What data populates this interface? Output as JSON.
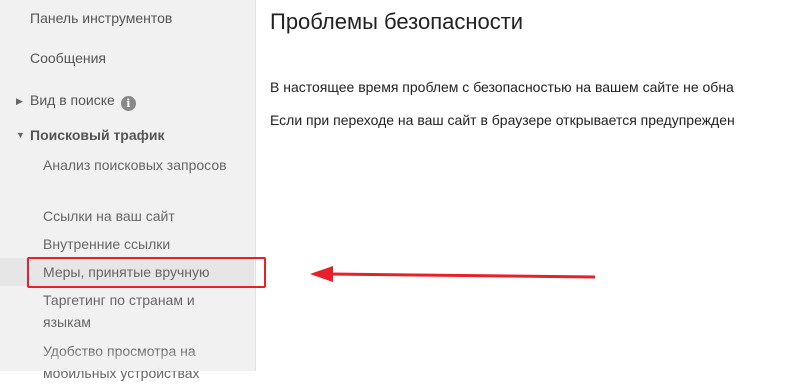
{
  "sidebar": {
    "dashboard": "Панель инструментов",
    "messages": "Сообщения",
    "search_appearance": "Вид в поиске",
    "search_traffic": "Поисковый трафик",
    "traffic_items": [
      "Анализ поисковых запросов",
      "Ссылки на ваш сайт",
      "Внутренние ссылки",
      "Меры, принятые вручную",
      "Таргетинг по странам и языкам",
      "Удобство просмотра на мобильных устройствах"
    ]
  },
  "icons": {
    "collapsed": "caret-right-icon",
    "expanded": "caret-down-icon",
    "info": "info-icon"
  },
  "main": {
    "title": "Проблемы безопасности",
    "line1": "В настоящее время проблем с безопасностью на вашем сайте не обна",
    "line2": "Если при переходе на ваш сайт в браузере открывается предупрежден"
  },
  "colors": {
    "highlight": "#e8202a",
    "sidebar_bg": "#f1f1f1"
  }
}
